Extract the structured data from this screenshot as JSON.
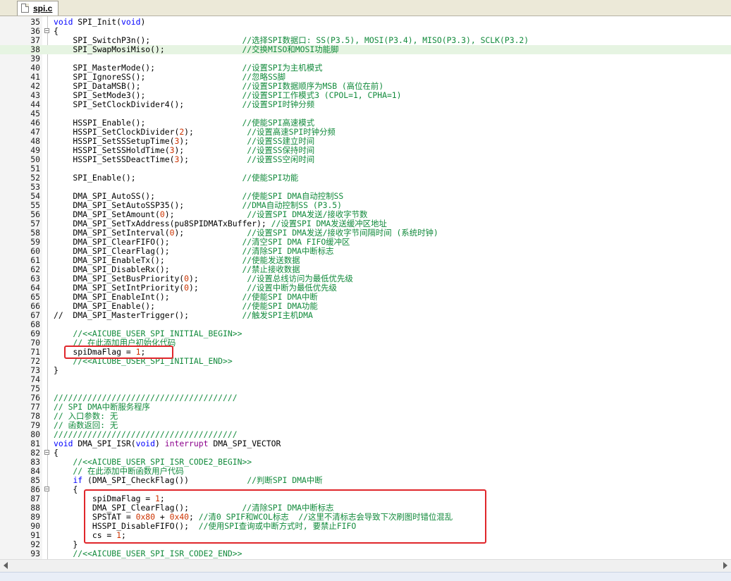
{
  "tab": {
    "label": "spi.c"
  },
  "lines": [
    {
      "n": "35",
      "fold": "",
      "segs": [
        [
          "c",
          "void"
        ],
        [
          "p",
          " SPI_Init("
        ],
        [
          "c",
          "void"
        ],
        [
          "p",
          ")"
        ]
      ]
    },
    {
      "n": "36",
      "fold": "−",
      "segs": [
        [
          "p",
          "{"
        ]
      ]
    },
    {
      "n": "37",
      "fold": "",
      "segs": [
        [
          "p",
          "    SPI_SwitchP3n();                   "
        ],
        [
          "cc",
          "//选择SPI数据口: SS(P3.5), MOSI(P3.4), MISO(P3.3), SCLK(P3.2)"
        ]
      ]
    },
    {
      "n": "38",
      "fold": "",
      "hl": true,
      "segs": [
        [
          "p",
          "    SPI_SwapMosiMiso();                "
        ],
        [
          "cc",
          "//交换MISO和MOSI功能脚"
        ]
      ]
    },
    {
      "n": "39",
      "fold": "",
      "segs": []
    },
    {
      "n": "40",
      "fold": "",
      "segs": [
        [
          "p",
          "    SPI_MasterMode();                  "
        ],
        [
          "cc",
          "//设置SPI为主机模式"
        ]
      ]
    },
    {
      "n": "41",
      "fold": "",
      "segs": [
        [
          "p",
          "    SPI_IgnoreSS();                    "
        ],
        [
          "cc",
          "//忽略SS脚"
        ]
      ]
    },
    {
      "n": "42",
      "fold": "",
      "segs": [
        [
          "p",
          "    SPI_DataMSB();                     "
        ],
        [
          "cc",
          "//设置SPI数据顺序为MSB (高位在前)"
        ]
      ]
    },
    {
      "n": "43",
      "fold": "",
      "segs": [
        [
          "p",
          "    SPI_SetMode3();                    "
        ],
        [
          "cc",
          "//设置SPI工作模式3 (CPOL=1, CPHA=1)"
        ]
      ]
    },
    {
      "n": "44",
      "fold": "",
      "segs": [
        [
          "p",
          "    SPI_SetClockDivider4();            "
        ],
        [
          "cc",
          "//设置SPI时钟分频"
        ]
      ]
    },
    {
      "n": "45",
      "fold": "",
      "segs": []
    },
    {
      "n": "46",
      "fold": "",
      "segs": [
        [
          "p",
          "    HSSPI_Enable();                    "
        ],
        [
          "cc",
          "//使能SPI高速模式"
        ]
      ]
    },
    {
      "n": "47",
      "fold": "",
      "segs": [
        [
          "p",
          "    HSSPI_SetClockDivider("
        ],
        [
          "cn",
          "2"
        ],
        [
          "p",
          ");           "
        ],
        [
          "cc",
          "//设置高速SPI时钟分频"
        ]
      ]
    },
    {
      "n": "48",
      "fold": "",
      "segs": [
        [
          "p",
          "    HSSPI_SetSSSetupTime("
        ],
        [
          "cn",
          "3"
        ],
        [
          "p",
          ");            "
        ],
        [
          "cc",
          "//设置SS建立时间"
        ]
      ]
    },
    {
      "n": "49",
      "fold": "",
      "segs": [
        [
          "p",
          "    HSSPI_SetSSHoldTime("
        ],
        [
          "cn",
          "3"
        ],
        [
          "p",
          ");             "
        ],
        [
          "cc",
          "//设置SS保持时间"
        ]
      ]
    },
    {
      "n": "50",
      "fold": "",
      "segs": [
        [
          "p",
          "    HSSPI_SetSSDeactTime("
        ],
        [
          "cn",
          "3"
        ],
        [
          "p",
          ");            "
        ],
        [
          "cc",
          "//设置SS空闲时间"
        ]
      ]
    },
    {
      "n": "51",
      "fold": "",
      "segs": []
    },
    {
      "n": "52",
      "fold": "",
      "segs": [
        [
          "p",
          "    SPI_Enable();                      "
        ],
        [
          "cc",
          "//使能SPI功能"
        ]
      ]
    },
    {
      "n": "53",
      "fold": "",
      "segs": []
    },
    {
      "n": "54",
      "fold": "",
      "segs": [
        [
          "p",
          "    DMA_SPI_AutoSS();                  "
        ],
        [
          "cc",
          "//使能SPI DMA自动控制SS"
        ]
      ]
    },
    {
      "n": "55",
      "fold": "",
      "segs": [
        [
          "p",
          "    DMA_SPI_SetAutoSSP35();            "
        ],
        [
          "cc",
          "//DMA自动控制SS (P3.5)"
        ]
      ]
    },
    {
      "n": "56",
      "fold": "",
      "segs": [
        [
          "p",
          "    DMA_SPI_SetAmount("
        ],
        [
          "cn",
          "0"
        ],
        [
          "p",
          ");               "
        ],
        [
          "cc",
          "//设置SPI DMA发送/接收字节数"
        ]
      ]
    },
    {
      "n": "57",
      "fold": "",
      "segs": [
        [
          "p",
          "    DMA_SPI_SetTxAddress(pu8SPIDMATxBuffer); "
        ],
        [
          "cc",
          "//设置SPI DMA发送缓冲区地址"
        ]
      ]
    },
    {
      "n": "58",
      "fold": "",
      "segs": [
        [
          "p",
          "    DMA_SPI_SetInterval("
        ],
        [
          "cn",
          "0"
        ],
        [
          "p",
          ");             "
        ],
        [
          "cc",
          "//设置SPI DMA发送/接收字节间隔时间 (系统时钟)"
        ]
      ]
    },
    {
      "n": "59",
      "fold": "",
      "segs": [
        [
          "p",
          "    DMA_SPI_ClearFIFO();               "
        ],
        [
          "cc",
          "//清空SPI DMA FIFO缓冲区"
        ]
      ]
    },
    {
      "n": "60",
      "fold": "",
      "segs": [
        [
          "p",
          "    DMA_SPI_ClearFlag();               "
        ],
        [
          "cc",
          "//清除SPI DMA中断标志"
        ]
      ]
    },
    {
      "n": "61",
      "fold": "",
      "segs": [
        [
          "p",
          "    DMA_SPI_EnableTx();                "
        ],
        [
          "cc",
          "//使能发送数据"
        ]
      ]
    },
    {
      "n": "62",
      "fold": "",
      "segs": [
        [
          "p",
          "    DMA_SPI_DisableRx();               "
        ],
        [
          "cc",
          "//禁止接收数据"
        ]
      ]
    },
    {
      "n": "63",
      "fold": "",
      "segs": [
        [
          "p",
          "    DMA_SPI_SetBusPriority("
        ],
        [
          "cn",
          "0"
        ],
        [
          "p",
          ");          "
        ],
        [
          "cc",
          "//设置总线访问为最低优先级"
        ]
      ]
    },
    {
      "n": "64",
      "fold": "",
      "segs": [
        [
          "p",
          "    DMA_SPI_SetIntPriority("
        ],
        [
          "cn",
          "0"
        ],
        [
          "p",
          ");          "
        ],
        [
          "cc",
          "//设置中断为最低优先级"
        ]
      ]
    },
    {
      "n": "65",
      "fold": "",
      "segs": [
        [
          "p",
          "    DMA_SPI_EnableInt();               "
        ],
        [
          "cc",
          "//使能SPI DMA中断"
        ]
      ]
    },
    {
      "n": "66",
      "fold": "",
      "segs": [
        [
          "p",
          "    DMA_SPI_Enable();                  "
        ],
        [
          "cc",
          "//使能SPI DMA功能"
        ]
      ]
    },
    {
      "n": "67",
      "fold": "",
      "segs": [
        [
          "p",
          "//  DMA_SPI_MasterTrigger();           "
        ],
        [
          "cc",
          "//触发SPI主机DMA"
        ]
      ]
    },
    {
      "n": "68",
      "fold": "",
      "segs": []
    },
    {
      "n": "69",
      "fold": "",
      "segs": [
        [
          "cc",
          "    //<<AICUBE_USER_SPI_INITIAL_BEGIN>>"
        ]
      ]
    },
    {
      "n": "70",
      "fold": "",
      "segs": [
        [
          "cc",
          "    // 在此添加用户初始化代码"
        ]
      ]
    },
    {
      "n": "71",
      "fold": "",
      "segs": [
        [
          "p",
          "    spiDmaFlag = "
        ],
        [
          "cn",
          "1"
        ],
        [
          "p",
          ";"
        ]
      ]
    },
    {
      "n": "72",
      "fold": "",
      "segs": [
        [
          "cc",
          "    //<<AICUBE_USER_SPI_INITIAL_END>>"
        ]
      ]
    },
    {
      "n": "73",
      "fold": "",
      "segs": [
        [
          "p",
          "}"
        ]
      ]
    },
    {
      "n": "74",
      "fold": "",
      "segs": []
    },
    {
      "n": "75",
      "fold": "",
      "segs": []
    },
    {
      "n": "76",
      "fold": "",
      "segs": [
        [
          "cc",
          "//////////////////////////////////////"
        ]
      ]
    },
    {
      "n": "77",
      "fold": "",
      "segs": [
        [
          "cc",
          "// SPI DMA中断服务程序"
        ]
      ]
    },
    {
      "n": "78",
      "fold": "",
      "segs": [
        [
          "cc",
          "// 入口参数: 无"
        ]
      ]
    },
    {
      "n": "79",
      "fold": "",
      "segs": [
        [
          "cc",
          "// 函数返回: 无"
        ]
      ]
    },
    {
      "n": "80",
      "fold": "",
      "segs": [
        [
          "cc",
          "//////////////////////////////////////"
        ]
      ]
    },
    {
      "n": "81",
      "fold": "",
      "segs": [
        [
          "c",
          "void"
        ],
        [
          "p",
          " DMA_SPI_ISR("
        ],
        [
          "c",
          "void"
        ],
        [
          "p",
          ") "
        ],
        [
          "ck",
          "interrupt"
        ],
        [
          "p",
          " DMA_SPI_VECTOR"
        ]
      ]
    },
    {
      "n": "82",
      "fold": "−",
      "segs": [
        [
          "p",
          "{"
        ]
      ]
    },
    {
      "n": "83",
      "fold": "",
      "segs": [
        [
          "cc",
          "    //<<AICUBE_USER_SPI_ISR_CODE2_BEGIN>>"
        ]
      ]
    },
    {
      "n": "84",
      "fold": "",
      "segs": [
        [
          "cc",
          "    // 在此添加中断函数用户代码"
        ]
      ]
    },
    {
      "n": "85",
      "fold": "",
      "segs": [
        [
          "p",
          "    "
        ],
        [
          "c",
          "if"
        ],
        [
          "p",
          " (DMA_SPI_CheckFlag())            "
        ],
        [
          "cc",
          "//判断SPI DMA中断"
        ]
      ]
    },
    {
      "n": "86",
      "fold": "−",
      "segs": [
        [
          "p",
          "    {"
        ]
      ]
    },
    {
      "n": "87",
      "fold": "",
      "segs": [
        [
          "p",
          "        spiDmaFlag = "
        ],
        [
          "cn",
          "1"
        ],
        [
          "p",
          ";"
        ]
      ]
    },
    {
      "n": "88",
      "fold": "",
      "segs": [
        [
          "p",
          "        DMA_SPI_ClearFlag();           "
        ],
        [
          "cc",
          "//清除SPI DMA中断标志"
        ]
      ]
    },
    {
      "n": "89",
      "fold": "",
      "segs": [
        [
          "p",
          "        SPSTAT = "
        ],
        [
          "cn",
          "0x80"
        ],
        [
          "p",
          " + "
        ],
        [
          "cn",
          "0x40"
        ],
        [
          "p",
          "; "
        ],
        [
          "cc",
          "//清0 SPIF和WCOL标志  //这里不清标志会导致下次刷图时错位混乱"
        ]
      ]
    },
    {
      "n": "90",
      "fold": "",
      "segs": [
        [
          "p",
          "        HSSPI_DisableFIFO();  "
        ],
        [
          "cc",
          "//使用SPI查询或中断方式时, 要禁止FIFO"
        ]
      ]
    },
    {
      "n": "91",
      "fold": "",
      "segs": [
        [
          "p",
          "        cs = "
        ],
        [
          "cn",
          "1"
        ],
        [
          "p",
          ";"
        ]
      ]
    },
    {
      "n": "92",
      "fold": "",
      "segs": [
        [
          "p",
          "    }"
        ]
      ]
    },
    {
      "n": "93",
      "fold": "",
      "segs": [
        [
          "cc",
          "    //<<AICUBE_USER_SPI_ISR_CODE2_END>>"
        ]
      ]
    }
  ],
  "colors": {
    "keyword": "#0000ff",
    "special_keyword": "#8b008b",
    "number": "#cc3300",
    "comment": "#118a3b",
    "highlight_line": "#e6f4e2",
    "annotation_box": "#e0262b"
  }
}
